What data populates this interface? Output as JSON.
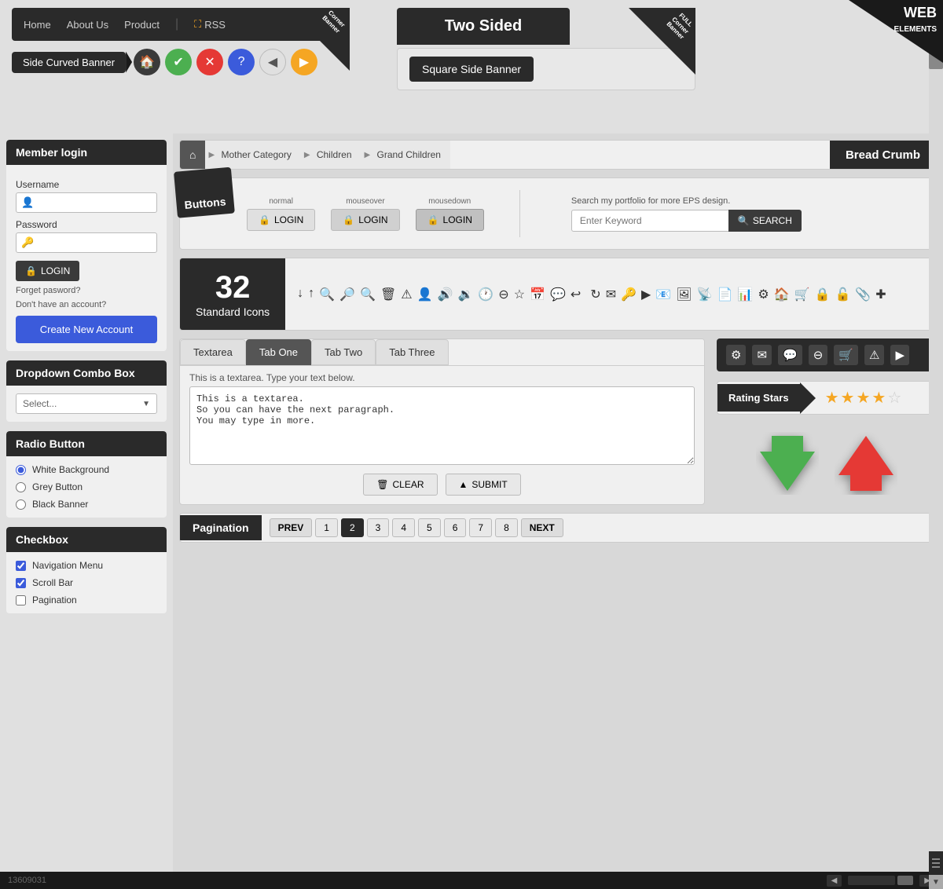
{
  "nav": {
    "items": [
      "Home",
      "About Us",
      "Product",
      "RSS"
    ],
    "corner_label": "Corner\nBanner"
  },
  "icons": {
    "home_icon": "🏠",
    "check_icon": "✔",
    "close_icon": "✕",
    "question_icon": "?",
    "back_icon": "◀",
    "fwd_icon": "▶"
  },
  "side_curved_banner": "Side Curved Banner",
  "two_sided": {
    "title": "Two Sided",
    "square_label": "Square Side Banner",
    "corner_text": "FULL\nCorner\nBanner"
  },
  "web_elements": "WEB\nELEMENTS",
  "breadcrumb": {
    "home_icon": "⌂",
    "items": [
      "Mother Category",
      "Children",
      "Grand Children"
    ],
    "label": "Bread Crumb"
  },
  "buttons_section": {
    "ribbon_text": "Buttons",
    "states": [
      "normal",
      "mouseover",
      "mousedown"
    ],
    "button_label": "LOGIN",
    "lock_icon": "🔒",
    "search_desc": "Search my portfolio for more EPS design.",
    "search_placeholder": "Enter Keyword",
    "search_btn": "SEARCH"
  },
  "icons_section": {
    "number": "32",
    "label": "Standard Icons",
    "symbols": [
      "↓",
      "↑",
      "🔍",
      "🔍",
      "🔍",
      "🗑",
      "⚠",
      "👤",
      "🔊",
      "◀",
      "🕐",
      "⊖",
      "☆",
      "📅",
      "💬",
      "↩",
      "↻",
      "✉",
      "🔑",
      "▶",
      "✉",
      "📷",
      "📡",
      "📄",
      "📊",
      "⚙",
      "🏠",
      "🛒",
      "🔒",
      "🔓",
      "📎",
      "✚"
    ]
  },
  "member_login": {
    "title": "Member login",
    "username_label": "Username",
    "password_label": "Password",
    "login_btn": "LOGIN",
    "forget_text": "Forget pasword?",
    "no_account_text": "Don't have an account?",
    "create_btn": "Create New Account"
  },
  "dropdown": {
    "title": "Dropdown Combo Box",
    "placeholder": "Select..."
  },
  "radio": {
    "title": "Radio Button",
    "options": [
      "White Background",
      "Grey Button",
      "Black Banner"
    ]
  },
  "checkbox": {
    "title": "Checkbox",
    "options": [
      {
        "label": "Navigation Menu",
        "checked": true
      },
      {
        "label": "Scroll Bar",
        "checked": true
      },
      {
        "label": "Pagination",
        "checked": false
      }
    ]
  },
  "textarea_section": {
    "tabs": [
      "Textarea",
      "Tab One",
      "Tab Two",
      "Tab Three"
    ],
    "active_tab": 0,
    "description": "This is a textarea. Type your text below.",
    "textarea_content": "This is a textarea.\nSo you can have the next paragraph.\nYou may type in more.",
    "clear_btn": "CLEAR",
    "submit_btn": "SUBMIT"
  },
  "dark_icons": [
    "⚙",
    "✉",
    "💬",
    "⊖",
    "🛒",
    "⚠",
    "▶"
  ],
  "rating": {
    "label": "Rating Stars",
    "stars": [
      "full",
      "full",
      "full",
      "half",
      "empty"
    ]
  },
  "pagination": {
    "label": "Pagination",
    "prev": "PREV",
    "next": "NEXT",
    "pages": [
      1,
      2,
      3,
      4,
      5,
      6,
      7,
      8
    ],
    "active_page": 2
  },
  "scrollbar": {
    "up": "▲",
    "down": "▼"
  },
  "bottom_bar": {
    "id_text": "13609031",
    "arrows": [
      "◀",
      "▶"
    ]
  }
}
